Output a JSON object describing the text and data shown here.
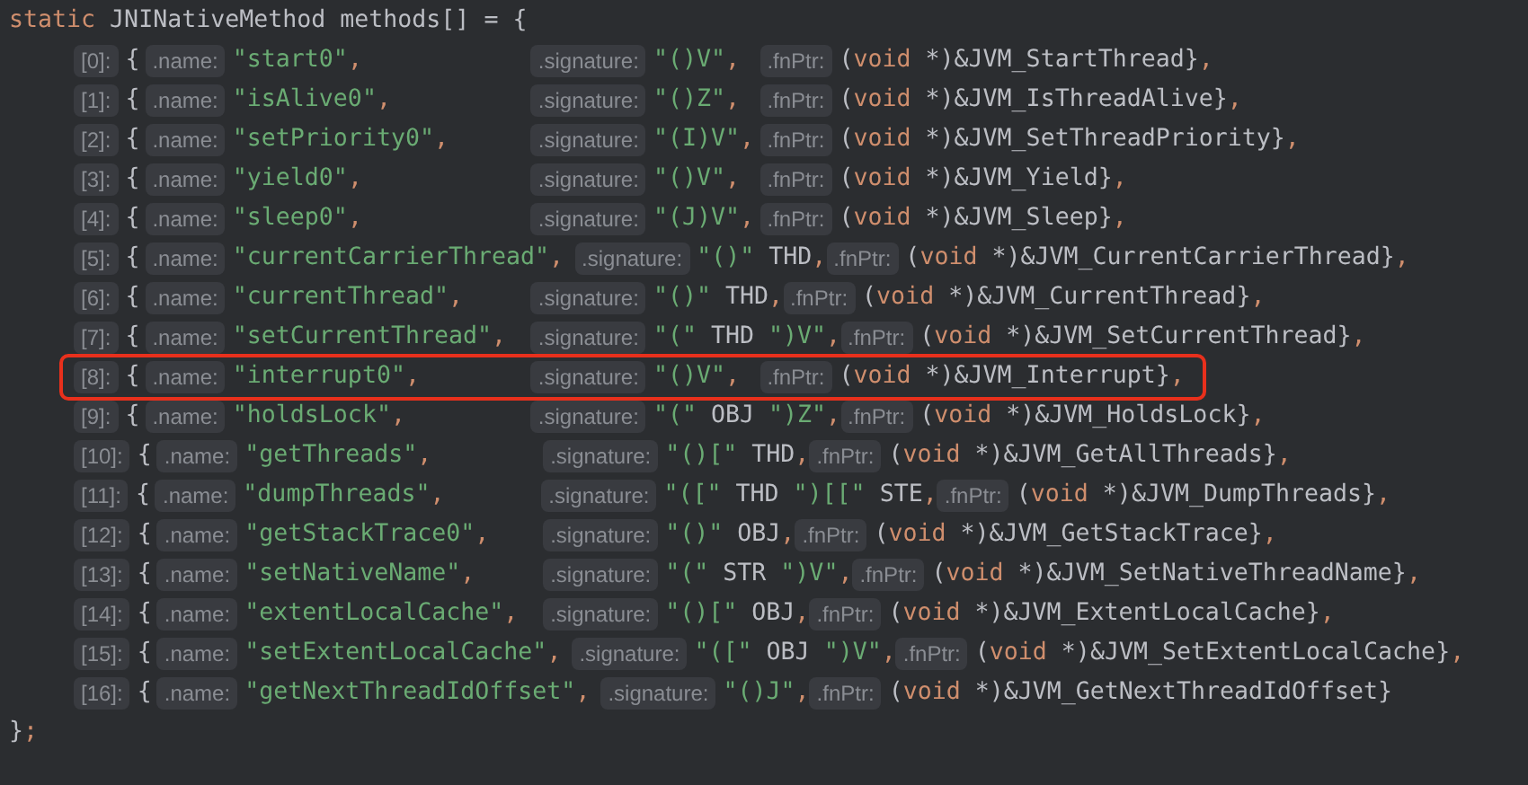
{
  "header": [
    {
      "kind": "kw",
      "text": "static"
    },
    {
      "kind": "plain",
      "text": " JNINativeMethod methods[] = {"
    }
  ],
  "rows": [
    {
      "index": "[0]:",
      "brace": "{",
      "name_hint": ".name:",
      "name": [
        {
          "kind": "str",
          "text": "\"start0\""
        },
        {
          "kind": "punct",
          "text": ","
        }
      ],
      "sig_hint": ".signature:",
      "sig": [
        {
          "kind": "str",
          "text": "\"()V\""
        },
        {
          "kind": "punct",
          "text": ","
        }
      ],
      "fn_hint": ".fnPtr:",
      "fn": [
        {
          "kind": "plain",
          "text": "("
        },
        {
          "kind": "kw",
          "text": "void"
        },
        {
          "kind": "plain",
          "text": " *)&JVM_StartThread}"
        },
        {
          "kind": "punct",
          "text": ","
        }
      ],
      "highlighted": false
    },
    {
      "index": "[1]:",
      "brace": "{",
      "name_hint": ".name:",
      "name": [
        {
          "kind": "str",
          "text": "\"isAlive0\""
        },
        {
          "kind": "punct",
          "text": ","
        }
      ],
      "sig_hint": ".signature:",
      "sig": [
        {
          "kind": "str",
          "text": "\"()Z\""
        },
        {
          "kind": "punct",
          "text": ","
        }
      ],
      "fn_hint": ".fnPtr:",
      "fn": [
        {
          "kind": "plain",
          "text": "("
        },
        {
          "kind": "kw",
          "text": "void"
        },
        {
          "kind": "plain",
          "text": " *)&JVM_IsThreadAlive}"
        },
        {
          "kind": "punct",
          "text": ","
        }
      ],
      "highlighted": false
    },
    {
      "index": "[2]:",
      "brace": "{",
      "name_hint": ".name:",
      "name": [
        {
          "kind": "str",
          "text": "\"setPriority0\""
        },
        {
          "kind": "punct",
          "text": ","
        }
      ],
      "sig_hint": ".signature:",
      "sig": [
        {
          "kind": "str",
          "text": "\"(I)V\""
        },
        {
          "kind": "punct",
          "text": ","
        }
      ],
      "fn_hint": ".fnPtr:",
      "fn": [
        {
          "kind": "plain",
          "text": "("
        },
        {
          "kind": "kw",
          "text": "void"
        },
        {
          "kind": "plain",
          "text": " *)&JVM_SetThreadPriority}"
        },
        {
          "kind": "punct",
          "text": ","
        }
      ],
      "highlighted": false
    },
    {
      "index": "[3]:",
      "brace": "{",
      "name_hint": ".name:",
      "name": [
        {
          "kind": "str",
          "text": "\"yield0\""
        },
        {
          "kind": "punct",
          "text": ","
        }
      ],
      "sig_hint": ".signature:",
      "sig": [
        {
          "kind": "str",
          "text": "\"()V\""
        },
        {
          "kind": "punct",
          "text": ","
        }
      ],
      "fn_hint": ".fnPtr:",
      "fn": [
        {
          "kind": "plain",
          "text": "("
        },
        {
          "kind": "kw",
          "text": "void"
        },
        {
          "kind": "plain",
          "text": " *)&JVM_Yield}"
        },
        {
          "kind": "punct",
          "text": ","
        }
      ],
      "highlighted": false
    },
    {
      "index": "[4]:",
      "brace": "{",
      "name_hint": ".name:",
      "name": [
        {
          "kind": "str",
          "text": "\"sleep0\""
        },
        {
          "kind": "punct",
          "text": ","
        }
      ],
      "sig_hint": ".signature:",
      "sig": [
        {
          "kind": "str",
          "text": "\"(J)V\""
        },
        {
          "kind": "punct",
          "text": ","
        }
      ],
      "fn_hint": ".fnPtr:",
      "fn": [
        {
          "kind": "plain",
          "text": "("
        },
        {
          "kind": "kw",
          "text": "void"
        },
        {
          "kind": "plain",
          "text": " *)&JVM_Sleep}"
        },
        {
          "kind": "punct",
          "text": ","
        }
      ],
      "highlighted": false
    },
    {
      "index": "[5]:",
      "brace": "{",
      "name_hint": ".name:",
      "name": [
        {
          "kind": "str",
          "text": "\"currentCarrierThread\""
        },
        {
          "kind": "punct",
          "text": ","
        }
      ],
      "sig_hint": ".signature:",
      "sig": [
        {
          "kind": "str",
          "text": "\"()\""
        },
        {
          "kind": "plain",
          "text": " THD"
        },
        {
          "kind": "punct",
          "text": ","
        }
      ],
      "fn_hint": ".fnPtr:",
      "fn": [
        {
          "kind": "plain",
          "text": "("
        },
        {
          "kind": "kw",
          "text": "void"
        },
        {
          "kind": "plain",
          "text": " *)&JVM_CurrentCarrierThread}"
        },
        {
          "kind": "punct",
          "text": ","
        }
      ],
      "highlighted": false
    },
    {
      "index": "[6]:",
      "brace": "{",
      "name_hint": ".name:",
      "name": [
        {
          "kind": "str",
          "text": "\"currentThread\""
        },
        {
          "kind": "punct",
          "text": ","
        }
      ],
      "sig_hint": ".signature:",
      "sig": [
        {
          "kind": "str",
          "text": "\"()\""
        },
        {
          "kind": "plain",
          "text": " THD"
        },
        {
          "kind": "punct",
          "text": ","
        }
      ],
      "fn_hint": ".fnPtr:",
      "fn": [
        {
          "kind": "plain",
          "text": "("
        },
        {
          "kind": "kw",
          "text": "void"
        },
        {
          "kind": "plain",
          "text": " *)&JVM_CurrentThread}"
        },
        {
          "kind": "punct",
          "text": ","
        }
      ],
      "highlighted": false
    },
    {
      "index": "[7]:",
      "brace": "{",
      "name_hint": ".name:",
      "name": [
        {
          "kind": "str",
          "text": "\"setCurrentThread\""
        },
        {
          "kind": "punct",
          "text": ","
        }
      ],
      "sig_hint": ".signature:",
      "sig": [
        {
          "kind": "str",
          "text": "\"(\""
        },
        {
          "kind": "plain",
          "text": " THD "
        },
        {
          "kind": "str",
          "text": "\")V\""
        },
        {
          "kind": "punct",
          "text": ","
        }
      ],
      "fn_hint": ".fnPtr:",
      "fn": [
        {
          "kind": "plain",
          "text": "("
        },
        {
          "kind": "kw",
          "text": "void"
        },
        {
          "kind": "plain",
          "text": " *)&JVM_SetCurrentThread}"
        },
        {
          "kind": "punct",
          "text": ","
        }
      ],
      "highlighted": false
    },
    {
      "index": "[8]:",
      "brace": "{",
      "name_hint": ".name:",
      "name": [
        {
          "kind": "str",
          "text": "\"interrupt0\""
        },
        {
          "kind": "punct",
          "text": ","
        }
      ],
      "sig_hint": ".signature:",
      "sig": [
        {
          "kind": "str",
          "text": "\"()V\""
        },
        {
          "kind": "punct",
          "text": ","
        }
      ],
      "fn_hint": ".fnPtr:",
      "fn": [
        {
          "kind": "plain",
          "text": "("
        },
        {
          "kind": "kw",
          "text": "void"
        },
        {
          "kind": "plain",
          "text": " *)&JVM_Interrupt}"
        },
        {
          "kind": "punct",
          "text": ","
        }
      ],
      "highlighted": true
    },
    {
      "index": "[9]:",
      "brace": "{",
      "name_hint": ".name:",
      "name": [
        {
          "kind": "str",
          "text": "\"holdsLock\""
        },
        {
          "kind": "punct",
          "text": ","
        }
      ],
      "sig_hint": ".signature:",
      "sig": [
        {
          "kind": "str",
          "text": "\"(\""
        },
        {
          "kind": "plain",
          "text": " OBJ "
        },
        {
          "kind": "str",
          "text": "\")Z\""
        },
        {
          "kind": "punct",
          "text": ","
        }
      ],
      "fn_hint": ".fnPtr:",
      "fn": [
        {
          "kind": "plain",
          "text": "("
        },
        {
          "kind": "kw",
          "text": "void"
        },
        {
          "kind": "plain",
          "text": " *)&JVM_HoldsLock}"
        },
        {
          "kind": "punct",
          "text": ","
        }
      ],
      "highlighted": false
    },
    {
      "index": "[10]:",
      "brace": "{",
      "name_hint": ".name:",
      "name": [
        {
          "kind": "str",
          "text": "\"getThreads\""
        },
        {
          "kind": "punct",
          "text": ","
        }
      ],
      "sig_hint": ".signature:",
      "sig": [
        {
          "kind": "str",
          "text": "\"()[\""
        },
        {
          "kind": "plain",
          "text": " THD"
        },
        {
          "kind": "punct",
          "text": ","
        }
      ],
      "fn_hint": ".fnPtr:",
      "fn": [
        {
          "kind": "plain",
          "text": "("
        },
        {
          "kind": "kw",
          "text": "void"
        },
        {
          "kind": "plain",
          "text": " *)&JVM_GetAllThreads}"
        },
        {
          "kind": "punct",
          "text": ","
        }
      ],
      "highlighted": false
    },
    {
      "index": "[11]:",
      "brace": "{",
      "name_hint": ".name:",
      "name": [
        {
          "kind": "str",
          "text": "\"dumpThreads\""
        },
        {
          "kind": "punct",
          "text": ","
        }
      ],
      "sig_hint": ".signature:",
      "sig": [
        {
          "kind": "str",
          "text": "\"([\""
        },
        {
          "kind": "plain",
          "text": " THD "
        },
        {
          "kind": "str",
          "text": "\")[[\""
        },
        {
          "kind": "plain",
          "text": " STE"
        },
        {
          "kind": "punct",
          "text": ","
        }
      ],
      "fn_hint": ".fnPtr:",
      "fn": [
        {
          "kind": "plain",
          "text": "("
        },
        {
          "kind": "kw",
          "text": "void"
        },
        {
          "kind": "plain",
          "text": " *)&JVM_DumpThreads}"
        },
        {
          "kind": "punct",
          "text": ","
        }
      ],
      "highlighted": false
    },
    {
      "index": "[12]:",
      "brace": "{",
      "name_hint": ".name:",
      "name": [
        {
          "kind": "str",
          "text": "\"getStackTrace0\""
        },
        {
          "kind": "punct",
          "text": ","
        }
      ],
      "sig_hint": ".signature:",
      "sig": [
        {
          "kind": "str",
          "text": "\"()\""
        },
        {
          "kind": "plain",
          "text": " OBJ"
        },
        {
          "kind": "punct",
          "text": ","
        }
      ],
      "fn_hint": ".fnPtr:",
      "fn": [
        {
          "kind": "plain",
          "text": "("
        },
        {
          "kind": "kw",
          "text": "void"
        },
        {
          "kind": "plain",
          "text": " *)&JVM_GetStackTrace}"
        },
        {
          "kind": "punct",
          "text": ","
        }
      ],
      "highlighted": false
    },
    {
      "index": "[13]:",
      "brace": "{",
      "name_hint": ".name:",
      "name": [
        {
          "kind": "str",
          "text": "\"setNativeName\""
        },
        {
          "kind": "punct",
          "text": ","
        }
      ],
      "sig_hint": ".signature:",
      "sig": [
        {
          "kind": "str",
          "text": "\"(\""
        },
        {
          "kind": "plain",
          "text": " STR "
        },
        {
          "kind": "str",
          "text": "\")V\""
        },
        {
          "kind": "punct",
          "text": ","
        }
      ],
      "fn_hint": ".fnPtr:",
      "fn": [
        {
          "kind": "plain",
          "text": "("
        },
        {
          "kind": "kw",
          "text": "void"
        },
        {
          "kind": "plain",
          "text": " *)&JVM_SetNativeThreadName}"
        },
        {
          "kind": "punct",
          "text": ","
        }
      ],
      "highlighted": false
    },
    {
      "index": "[14]:",
      "brace": "{",
      "name_hint": ".name:",
      "name": [
        {
          "kind": "str",
          "text": "\"extentLocalCache\""
        },
        {
          "kind": "punct",
          "text": ","
        }
      ],
      "sig_hint": ".signature:",
      "sig": [
        {
          "kind": "str",
          "text": "\"()[\""
        },
        {
          "kind": "plain",
          "text": " OBJ"
        },
        {
          "kind": "punct",
          "text": ","
        }
      ],
      "fn_hint": ".fnPtr:",
      "fn": [
        {
          "kind": "plain",
          "text": "("
        },
        {
          "kind": "kw",
          "text": "void"
        },
        {
          "kind": "plain",
          "text": " *)&JVM_ExtentLocalCache}"
        },
        {
          "kind": "punct",
          "text": ","
        }
      ],
      "highlighted": false
    },
    {
      "index": "[15]:",
      "brace": "{",
      "name_hint": ".name:",
      "name": [
        {
          "kind": "str",
          "text": "\"setExtentLocalCache\""
        },
        {
          "kind": "punct",
          "text": ","
        }
      ],
      "sig_hint": ".signature:",
      "sig": [
        {
          "kind": "str",
          "text": "\"([\""
        },
        {
          "kind": "plain",
          "text": " OBJ "
        },
        {
          "kind": "str",
          "text": "\")V\""
        },
        {
          "kind": "punct",
          "text": ","
        }
      ],
      "fn_hint": ".fnPtr:",
      "fn": [
        {
          "kind": "plain",
          "text": "("
        },
        {
          "kind": "kw",
          "text": "void"
        },
        {
          "kind": "plain",
          "text": " *)&JVM_SetExtentLocalCache}"
        },
        {
          "kind": "punct",
          "text": ","
        }
      ],
      "highlighted": false
    },
    {
      "index": "[16]:",
      "brace": "{",
      "name_hint": ".name:",
      "name": [
        {
          "kind": "str",
          "text": "\"getNextThreadIdOffset\""
        },
        {
          "kind": "punct",
          "text": ","
        }
      ],
      "sig_hint": ".signature:",
      "sig": [
        {
          "kind": "str",
          "text": "\"()J\""
        },
        {
          "kind": "punct",
          "text": ","
        }
      ],
      "fn_hint": ".fnPtr:",
      "fn": [
        {
          "kind": "plain",
          "text": "("
        },
        {
          "kind": "kw",
          "text": "void"
        },
        {
          "kind": "plain",
          "text": " *)&JVM_GetNextThreadIdOffset}"
        }
      ],
      "highlighted": false
    }
  ],
  "footer": [
    {
      "kind": "plain",
      "text": "}"
    },
    {
      "kind": "punct",
      "text": ";"
    }
  ]
}
